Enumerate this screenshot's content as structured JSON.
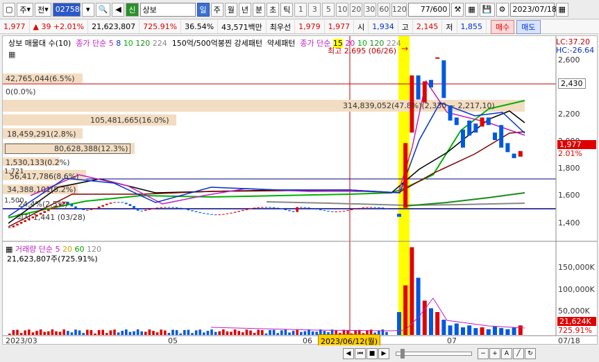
{
  "toolbar": {
    "left_label": "주",
    "cmp_label": "전",
    "code": "027580",
    "market_icon": "신",
    "name": "상보",
    "period_tabs": [
      "일",
      "주",
      "월",
      "년",
      "분",
      "초",
      "틱"
    ],
    "period_active": "일",
    "intervals": [
      "1",
      "3",
      "5",
      "10",
      "20",
      "30",
      "60",
      "120"
    ],
    "page_count": "77/600",
    "date": "2023/07/18"
  },
  "quote": {
    "price": "1,977",
    "change_arrow": "▲",
    "change": "39",
    "change_pct": "+2.01%",
    "volume": "21,623,807",
    "volume_ratio": "725.91%",
    "turnover": "36.54%",
    "amount": "43,571백만",
    "best_ask_label": "최우선",
    "ask": "1,979",
    "bid": "1,977",
    "open_label": "시",
    "open": "1,934",
    "high_label": "고",
    "high": "2,145",
    "low_label": "저",
    "low": "1,855",
    "buy_label": "매수",
    "sell_label": "매도"
  },
  "chart": {
    "title": "상보 매물대 수(10)",
    "ma_label": "종가 단순",
    "ma_periods": [
      "5",
      "8",
      "10",
      "120",
      "224"
    ],
    "tool_title": "150억/500억봉찐 강세패턴",
    "weak_title": "약세패턴",
    "ma2_label": "종가 단순",
    "ma2_periods": [
      "15",
      "20",
      "10",
      "120",
      "224"
    ],
    "high_note": "최고 2,695 (06/26)",
    "low_note": "최저 1,441 (03/28)",
    "lc": "LC:37.20",
    "hc": "HC:-26.64",
    "y_ticks": [
      "2,600",
      "2,400",
      "2,200",
      "2,000",
      "1,800",
      "1,600",
      "1,400"
    ],
    "right_box": "2,430",
    "current_price": "1,977",
    "current_pct": "2.01%",
    "volume_profile": [
      "42,765,044(6.5%)",
      "0(0.0%)",
      "314,839,052(47.8%)(2,330 ~ 2,217,10)",
      "105,481,665(16.0%)",
      "18,459,291(2.8%)",
      "80,628,388(12.3%)",
      "1,530,133(0.2%)",
      "56,417,786(8.6%)",
      "34,388,101(5.2%)",
      "1,721",
      "1,500",
      "24,4%(2.5%)"
    ]
  },
  "volume_panel": {
    "title": "거래량",
    "ma_label": "단순",
    "ma_periods": [
      "5",
      "20",
      "60",
      "120"
    ],
    "total": "21,623,807주(725.91%)",
    "ticks": [
      "150,000K",
      "100,000K",
      "50,000K"
    ],
    "current": "21,624K",
    "current_pct": "725.91%"
  },
  "x_axis": [
    "2023/03",
    "05",
    "06",
    "07",
    "07/18"
  ],
  "crosshair_date": "2023/06/12(월)",
  "colors": {
    "up": "#e00000",
    "down": "#0058e0",
    "highlight": "#ffff00",
    "hline": "#0000a0"
  },
  "chart_data": {
    "type": "candlestick",
    "price_axis": {
      "min": 1400,
      "max": 2700
    },
    "dates": [
      "2023/03",
      "05",
      "06",
      "07",
      "07/18"
    ],
    "highlighted_day": "2023/06/26",
    "last": {
      "price": 1977,
      "change_pct": 2.01,
      "volume": 21623807
    }
  }
}
